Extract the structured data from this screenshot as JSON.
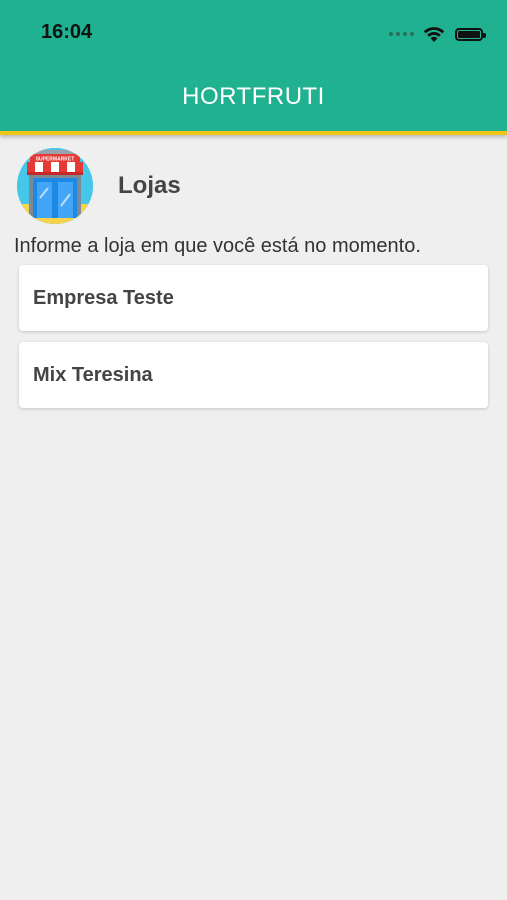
{
  "status_bar": {
    "time": "16:04"
  },
  "app_bar": {
    "title": "HORTFRUTI"
  },
  "section": {
    "icon": "supermarket-icon",
    "icon_sign_text": "SUPERMARKET",
    "title": "Lojas",
    "instruction": "Informe a loja em que você está no momento."
  },
  "stores": [
    {
      "name": "Empresa Teste"
    },
    {
      "name": "Mix Teresina"
    }
  ],
  "colors": {
    "app_bar": "#20b190",
    "app_bar_accent": "#f0c419",
    "background": "#efefef",
    "card": "#ffffff"
  }
}
